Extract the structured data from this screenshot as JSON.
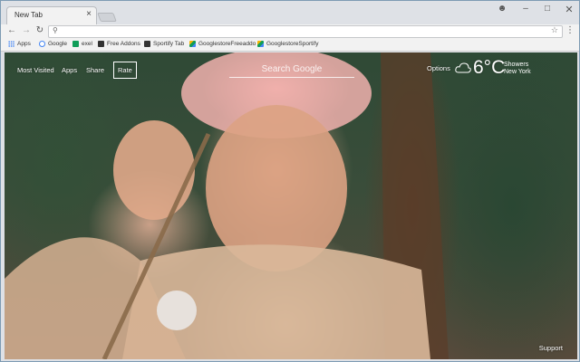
{
  "browser": {
    "tab_title": "New Tab",
    "tab_close": "×",
    "bookmarks": [
      {
        "label": "Apps",
        "icon": "apps-grid-icon"
      },
      {
        "label": "Google",
        "icon": "google-icon"
      },
      {
        "label": "exel",
        "icon": "sheets-icon"
      },
      {
        "label": "Free Addons",
        "icon": "addon-icon"
      },
      {
        "label": "Sportify Tab",
        "icon": "addon-icon"
      },
      {
        "label": "GooglestoreFreeaddo",
        "icon": "drive-icon"
      },
      {
        "label": "GooglestoreSportify",
        "icon": "drive-icon"
      }
    ]
  },
  "newtab": {
    "nav": {
      "most_visited": "Most Visited",
      "apps": "Apps",
      "share": "Share",
      "rate": "Rate"
    },
    "search": {
      "placeholder": "Search Google"
    },
    "options": "Options",
    "weather": {
      "temperature": "6°C",
      "condition": "Showers",
      "city": "New York"
    },
    "support": "Support"
  }
}
